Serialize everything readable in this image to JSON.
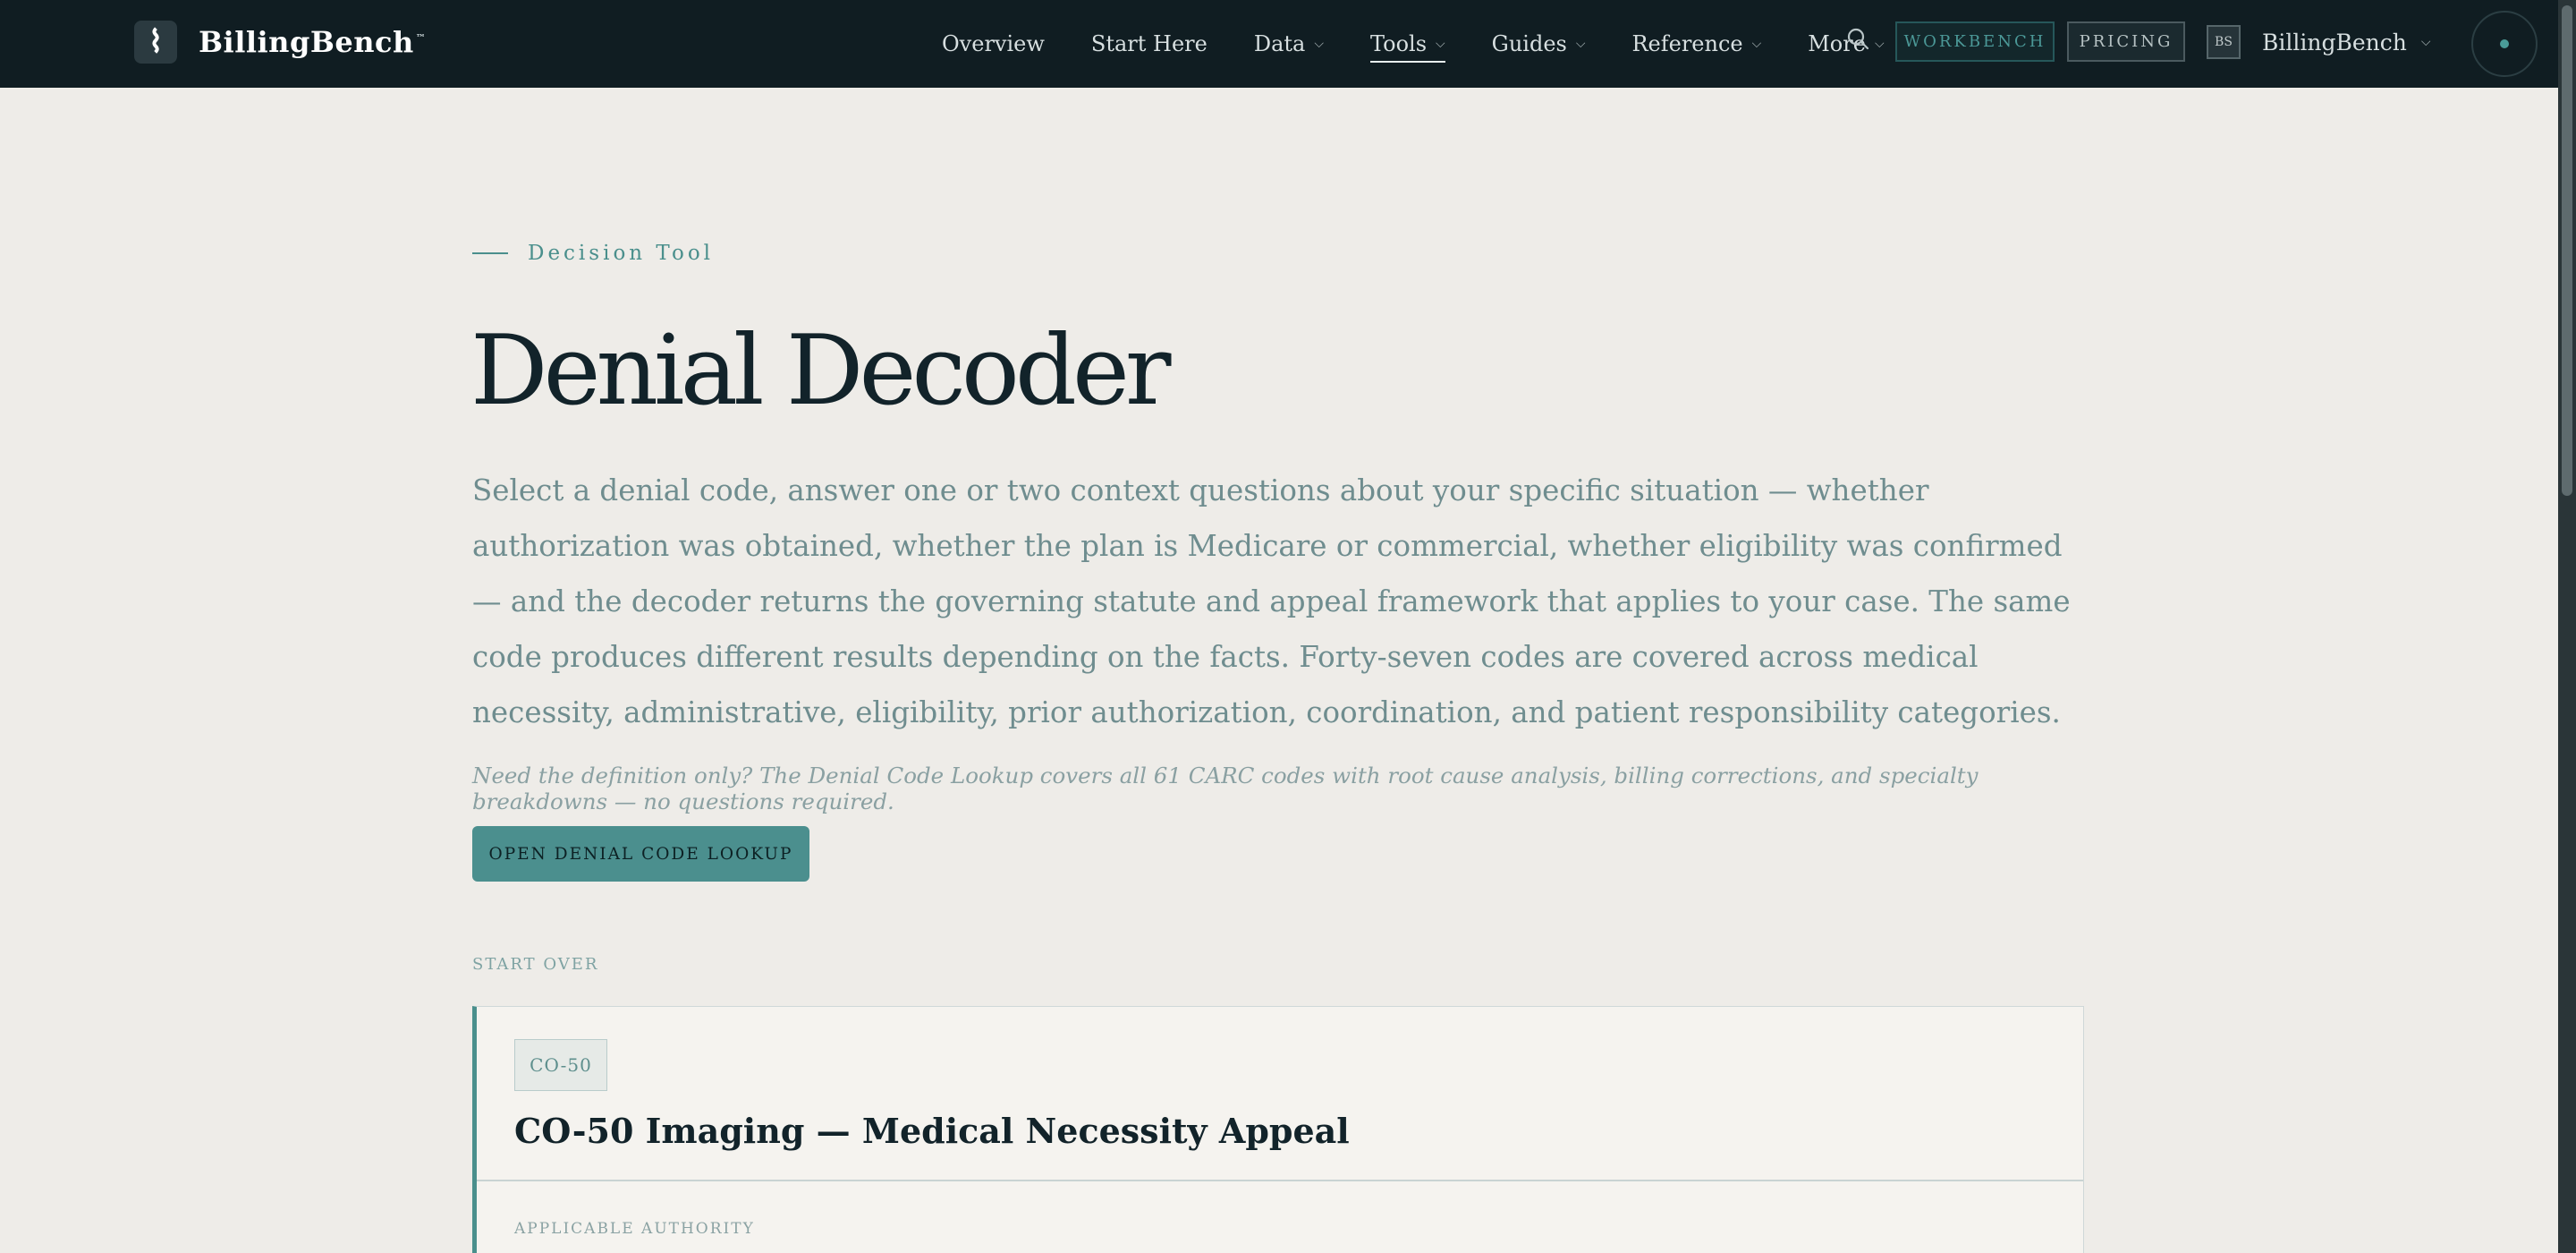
{
  "brand": {
    "logo_glyph": "⌇",
    "name": "BillingBench",
    "tm": "™"
  },
  "nav": {
    "items": [
      {
        "label": "Overview",
        "has_menu": false,
        "active": false
      },
      {
        "label": "Start Here",
        "has_menu": false,
        "active": false
      },
      {
        "label": "Data",
        "has_menu": true,
        "active": false
      },
      {
        "label": "Tools",
        "has_menu": true,
        "active": true
      },
      {
        "label": "Guides",
        "has_menu": true,
        "active": false
      },
      {
        "label": "Reference",
        "has_menu": true,
        "active": false
      },
      {
        "label": "More",
        "has_menu": true,
        "active": false
      }
    ],
    "workbench_label": "WORKBENCH",
    "pricing_label": "PRICING",
    "avatar_initials": "BS",
    "account_label": "BillingBench"
  },
  "hero": {
    "eyebrow": "Decision Tool",
    "title": "Denial Decoder",
    "intro": "Select a denial code, answer one or two context questions about your specific situation — whether authorization was obtained, whether the plan is Medicare or commercial, whether eligibility was confirmed — and the decoder returns the governing statute and appeal framework that applies to your case. The same code produces different results depending on the facts. Forty-seven codes are covered across medical necessity, administrative, eligibility, prior authorization, coordination, and patient responsibility categories.",
    "note": "Need the definition only? The Denial Code Lookup covers all 61 CARC codes with root cause analysis, billing corrections, and specialty breakdowns — no questions required.",
    "cta_label": "OPEN DENIAL CODE LOOKUP"
  },
  "start_over_label": "START OVER",
  "result_card": {
    "code": "CO-50",
    "title": "CO-50 Imaging — Medical Necessity Appeal",
    "section_label": "APPLICABLE AUTHORITY"
  },
  "colors": {
    "nav_bg": "#101d22",
    "page_bg": "#eeece8",
    "accent": "#4a8f8c",
    "heading": "#12232a"
  }
}
